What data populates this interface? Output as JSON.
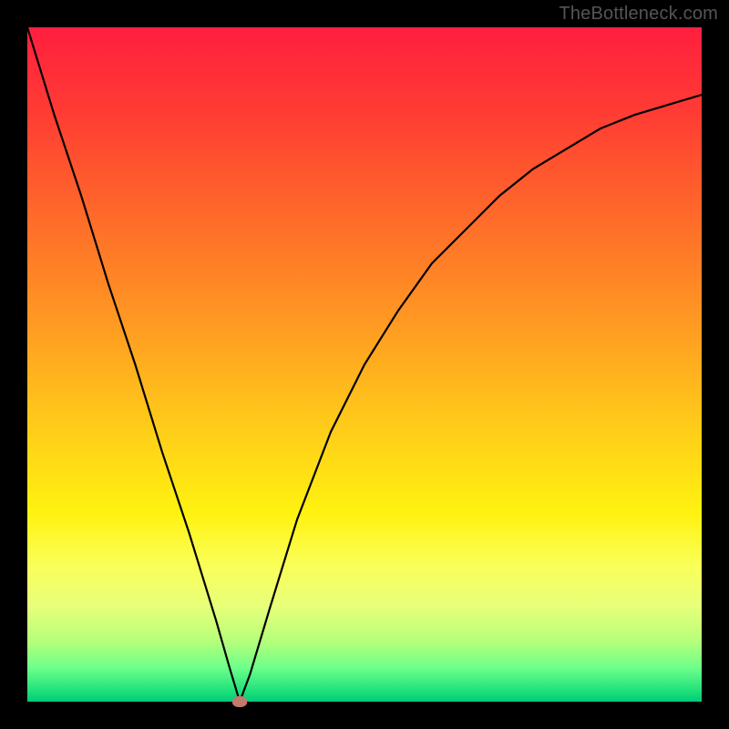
{
  "watermark": "TheBottleneck.com",
  "colors": {
    "gradient_stops": [
      {
        "offset": 0.0,
        "color": "#ff1f3f"
      },
      {
        "offset": 0.12,
        "color": "#ff3a34"
      },
      {
        "offset": 0.28,
        "color": "#ff6a2a"
      },
      {
        "offset": 0.44,
        "color": "#ff9a22"
      },
      {
        "offset": 0.58,
        "color": "#ffc81a"
      },
      {
        "offset": 0.72,
        "color": "#fff210"
      },
      {
        "offset": 0.8,
        "color": "#faff5a"
      },
      {
        "offset": 0.86,
        "color": "#e6ff7a"
      },
      {
        "offset": 0.91,
        "color": "#b6ff7a"
      },
      {
        "offset": 0.95,
        "color": "#6cff8a"
      },
      {
        "offset": 0.985,
        "color": "#1de07a"
      },
      {
        "offset": 1.0,
        "color": "#00c97a"
      }
    ],
    "curve": "#000000",
    "frame": "#000000",
    "marker": "#c17a6d"
  },
  "chart_data": {
    "type": "line",
    "title": "",
    "xlabel": "",
    "ylabel": "",
    "xlim": [
      0,
      1
    ],
    "ylim": [
      0,
      1
    ],
    "series": [
      {
        "name": "bottleneck-curve",
        "x": [
          0.0,
          0.04,
          0.08,
          0.12,
          0.16,
          0.2,
          0.24,
          0.28,
          0.3,
          0.315,
          0.33,
          0.36,
          0.4,
          0.45,
          0.5,
          0.55,
          0.6,
          0.65,
          0.7,
          0.75,
          0.8,
          0.85,
          0.9,
          0.95,
          1.0
        ],
        "y": [
          1.0,
          0.87,
          0.75,
          0.62,
          0.5,
          0.37,
          0.25,
          0.12,
          0.05,
          0.0,
          0.04,
          0.14,
          0.27,
          0.4,
          0.5,
          0.58,
          0.65,
          0.7,
          0.75,
          0.79,
          0.82,
          0.85,
          0.87,
          0.885,
          0.9
        ]
      }
    ],
    "annotations": [
      {
        "name": "minimum-marker",
        "x": 0.315,
        "y": 0.0
      }
    ]
  }
}
